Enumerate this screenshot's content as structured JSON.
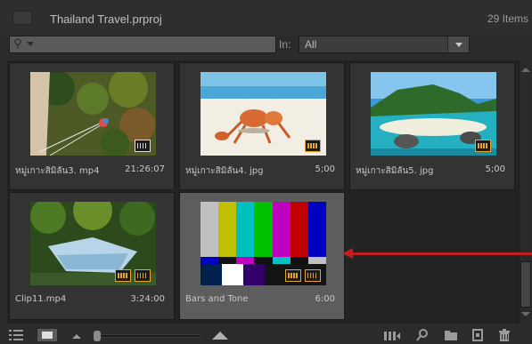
{
  "header": {
    "project_title": "Thailand Travel.prproj",
    "item_count": "29 Items"
  },
  "search": {
    "placeholder": "",
    "in_label": "In:",
    "in_value": "All"
  },
  "items": [
    {
      "name": "หมู่เกาะสิมิลัน3. mp4",
      "duration": "21:26:07",
      "badges": [
        "audio"
      ]
    },
    {
      "name": "หมู่เกาะสิมิลัน4. jpg",
      "duration": "5;00",
      "badges": [
        "film"
      ]
    },
    {
      "name": "หมู่เกาะสิมิลัน5. jpg",
      "duration": "5;00",
      "badges": [
        "film"
      ]
    },
    {
      "name": "Clip11.mp4",
      "duration": "3:24:00",
      "badges": [
        "film",
        "audio"
      ]
    },
    {
      "name": "Bars and Tone",
      "duration": "6:00",
      "badges": [
        "film",
        "audio"
      ],
      "selected": true
    }
  ],
  "colors": {
    "accent_orange": "#e7a530",
    "annotation_red": "#c41f1f",
    "panel_bg": "#2b2b2b",
    "selected_cell": "#5d5d5d"
  },
  "icons": {
    "list_view": "list-view-icon",
    "icon_view": "icon-view-icon",
    "zoom_small": "zoom-small-icon",
    "zoom_large": "zoom-large-icon",
    "automate": "automate-to-sequence-icon",
    "find": "find-icon",
    "new_bin": "new-bin-icon",
    "new_item": "new-item-icon",
    "trash": "trash-icon"
  }
}
